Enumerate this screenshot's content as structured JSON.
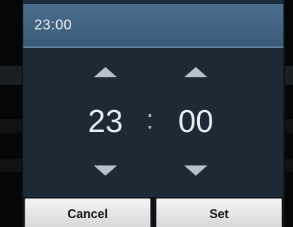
{
  "dialog": {
    "title": "23:00"
  },
  "picker": {
    "hour": "23",
    "minute": "00",
    "separator": ":"
  },
  "buttons": {
    "cancel_label": "Cancel",
    "set_label": "Set"
  },
  "icons": {
    "hour_up": "chevron-up-icon",
    "hour_down": "chevron-down-icon",
    "minute_up": "chevron-up-icon",
    "minute_down": "chevron-down-icon"
  },
  "colors": {
    "title_bar": "#3f5f7d",
    "picker_background": "#1d2a36",
    "arrow": "#b9c2c9",
    "digits": "#e9eef2",
    "button_background": "#e6e6e6"
  }
}
